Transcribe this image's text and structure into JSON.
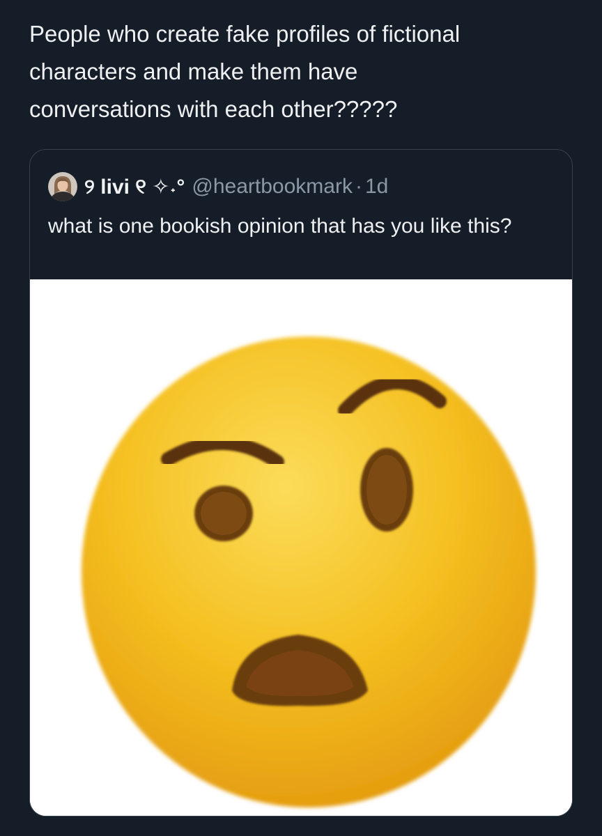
{
  "tweet": {
    "text": "People who create fake profiles of fictional\ncharacters and make them have\nconversations with each other?????"
  },
  "quoted_tweet": {
    "display_name": "୨ livi ୧ ✧˖°",
    "handle": "@heartbookmark",
    "separator": "·",
    "time": "1d",
    "text": "what is one bookish opinion that has you like this?",
    "avatar_icon": "profile-photo",
    "media_icon": "face-with-raised-eyebrow-emoji",
    "media_background": "#ffffff"
  },
  "colors": {
    "background": "#151d28",
    "text": "#e7e9ea",
    "secondary_text": "#8b98a5",
    "border": "#38444d",
    "emoji_yellow": "#f5c021",
    "emoji_feature": "#6b3d10"
  }
}
